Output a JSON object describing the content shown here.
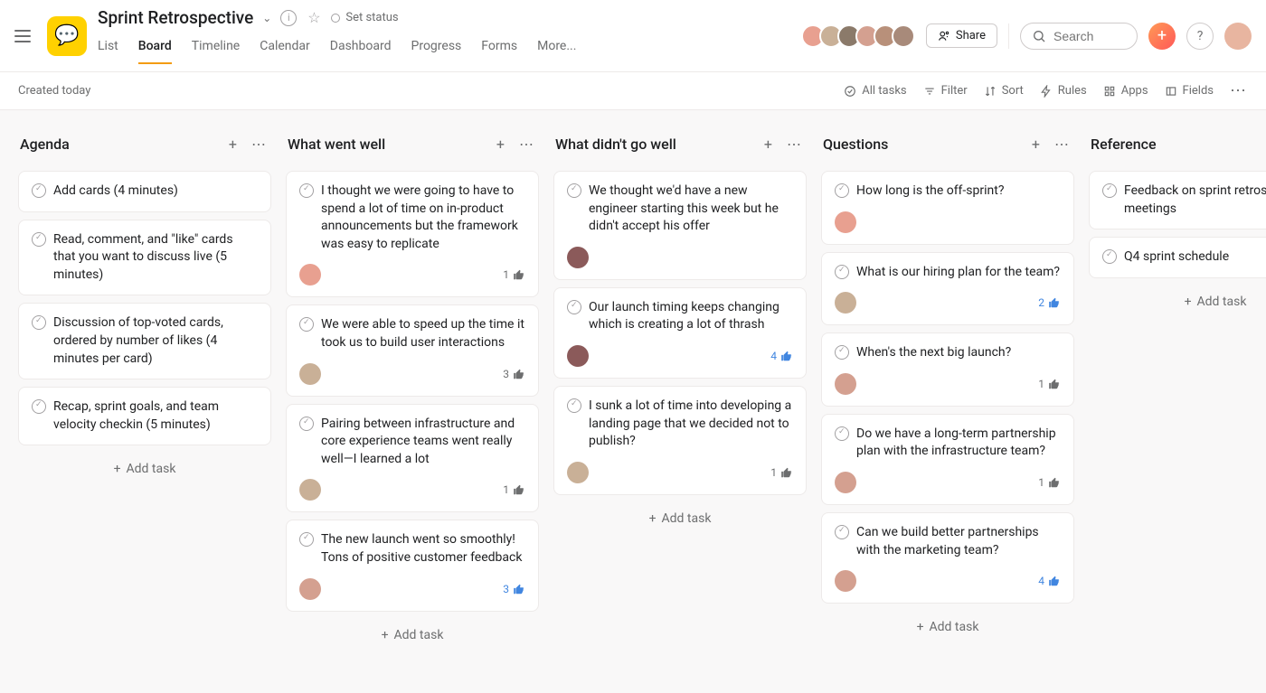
{
  "project": {
    "title": "Sprint Retrospective",
    "set_status": "Set status"
  },
  "tabs": [
    "List",
    "Board",
    "Timeline",
    "Calendar",
    "Dashboard",
    "Progress",
    "Forms",
    "More..."
  ],
  "active_tab": 1,
  "share": "Share",
  "search_placeholder": "Search",
  "created": "Created today",
  "toolbar": {
    "all_tasks": "All tasks",
    "filter": "Filter",
    "sort": "Sort",
    "rules": "Rules",
    "apps": "Apps",
    "fields": "Fields"
  },
  "add_task": "Add task",
  "columns": [
    {
      "title": "Agenda",
      "cards": [
        {
          "text": "Add cards (4 minutes)"
        },
        {
          "text": "Read, comment, and \"like\" cards that you want to discuss live (5 minutes)"
        },
        {
          "text": "Discussion of top-voted cards, ordered by number of likes (4 minutes per card)"
        },
        {
          "text": "Recap, sprint goals, and team velocity checkin (5 minutes)"
        }
      ]
    },
    {
      "title": "What went well",
      "cards": [
        {
          "text": "I thought we were going to have to spend a lot of time on in-product announcements but the framework was easy to replicate",
          "avatar": "#e8a090",
          "likes": 1,
          "like_color": "gray"
        },
        {
          "text": "We were able to speed up the time it took us to build user interactions",
          "avatar": "#c9b097",
          "likes": 3,
          "like_color": "gray"
        },
        {
          "text": "Pairing between infrastructure and core experience teams went really well—I learned a lot",
          "avatar": "#c9b097",
          "likes": 1,
          "like_color": "gray"
        },
        {
          "text": "The new launch went so smoothly! Tons of positive customer feedback",
          "avatar": "#d4a090",
          "likes": 3,
          "like_color": "blue"
        }
      ]
    },
    {
      "title": "What didn't go well",
      "cards": [
        {
          "text": "We thought we'd have a new engineer starting this week but he didn't accept his offer",
          "avatar": "#8b5a5a"
        },
        {
          "text": "Our launch timing keeps changing which is creating a lot of thrash",
          "avatar": "#8b5a5a",
          "likes": 4,
          "like_color": "blue"
        },
        {
          "text": "I sunk a lot of time into developing a landing page that we decided not to publish?",
          "avatar": "#c9b097",
          "likes": 1,
          "like_color": "gray"
        }
      ]
    },
    {
      "title": "Questions",
      "cards": [
        {
          "text": "How long is the off-sprint?",
          "avatar": "#e8a090"
        },
        {
          "text": "What is our hiring plan for the team?",
          "avatar": "#c9b097",
          "likes": 2,
          "like_color": "blue"
        },
        {
          "text": "When's the next big launch?",
          "avatar": "#d4a090",
          "likes": 1,
          "like_color": "gray"
        },
        {
          "text": "Do we have a long-term partnership plan with the infrastructure team?",
          "avatar": "#d4a090",
          "likes": 1,
          "like_color": "gray"
        },
        {
          "text": "Can we build better partnerships with the marketing team?",
          "avatar": "#d4a090",
          "likes": 4,
          "like_color": "blue"
        }
      ]
    },
    {
      "title": "Reference",
      "cards": [
        {
          "text": "Feedback on sprint retrosp meetings"
        },
        {
          "text": "Q4 sprint schedule"
        }
      ]
    }
  ],
  "header_avatars": [
    "#e8a090",
    "#c9b097",
    "#8b7a6a",
    "#d4a090",
    "#b8907a",
    "#a88a7a"
  ]
}
